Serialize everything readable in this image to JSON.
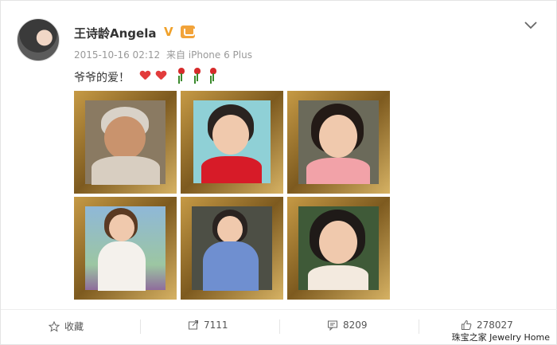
{
  "author": {
    "name": "王诗龄Angela",
    "verified_mark": "V"
  },
  "meta": {
    "timestamp": "2015-10-16 02:12",
    "source": "来自 iPhone 6 Plus"
  },
  "post": {
    "text": "爷爷的爱！"
  },
  "photos": [
    {
      "alt": "portrait-1"
    },
    {
      "alt": "portrait-2"
    },
    {
      "alt": "portrait-3"
    },
    {
      "alt": "portrait-4"
    },
    {
      "alt": "portrait-5"
    },
    {
      "alt": "portrait-6"
    }
  ],
  "actions": {
    "favorite": "收藏",
    "repost": "7111",
    "comment": "8209",
    "like": "278027"
  },
  "watermark": "珠宝之家  Jewelry Home",
  "colors": {
    "accent": "#f0a12a",
    "heart": "#e23b3b",
    "muted": "#999999"
  },
  "icons": {
    "more": "chevron-down-icon",
    "favorite": "star-icon",
    "repost": "repost-icon",
    "comment": "comment-icon",
    "like": "thumb-up-icon"
  }
}
